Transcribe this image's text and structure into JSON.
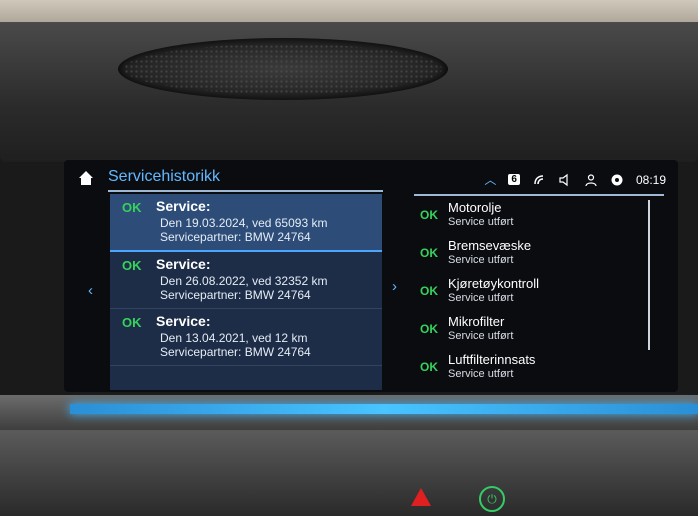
{
  "header": {
    "title": "Servicehistorikk",
    "badge": "6",
    "time": "08:19"
  },
  "service_records": [
    {
      "status": "OK",
      "heading": "Service:",
      "date_line": "Den 19.03.2024, ved 65093 km",
      "partner_line": "Servicepartner: BMW 24764",
      "selected": true
    },
    {
      "status": "OK",
      "heading": "Service:",
      "date_line": "Den 26.08.2022, ved 32352 km",
      "partner_line": "Servicepartner: BMW 24764",
      "selected": false
    },
    {
      "status": "OK",
      "heading": "Service:",
      "date_line": "Den 13.04.2021, ved 12 km",
      "partner_line": "Servicepartner: BMW 24764",
      "selected": false
    }
  ],
  "service_items": [
    {
      "status": "OK",
      "name": "Motorolje",
      "sub": "Service utført"
    },
    {
      "status": "OK",
      "name": "Bremsevæske",
      "sub": "Service utført"
    },
    {
      "status": "OK",
      "name": "Kjøretøykontroll",
      "sub": "Service utført"
    },
    {
      "status": "OK",
      "name": "Mikrofilter",
      "sub": "Service utført"
    },
    {
      "status": "OK",
      "name": "Luftfilterinnsats",
      "sub": "Service utført"
    }
  ],
  "icons": [
    "home-icon",
    "chevron-up-icon",
    "connectivity-icon",
    "speaker-icon",
    "profile-icon",
    "climate-icon",
    "chevron-left-icon",
    "chevron-right-icon"
  ],
  "colors": {
    "accent": "#62b8ff",
    "ok": "#35d35b",
    "selected": "#2d4d78"
  }
}
